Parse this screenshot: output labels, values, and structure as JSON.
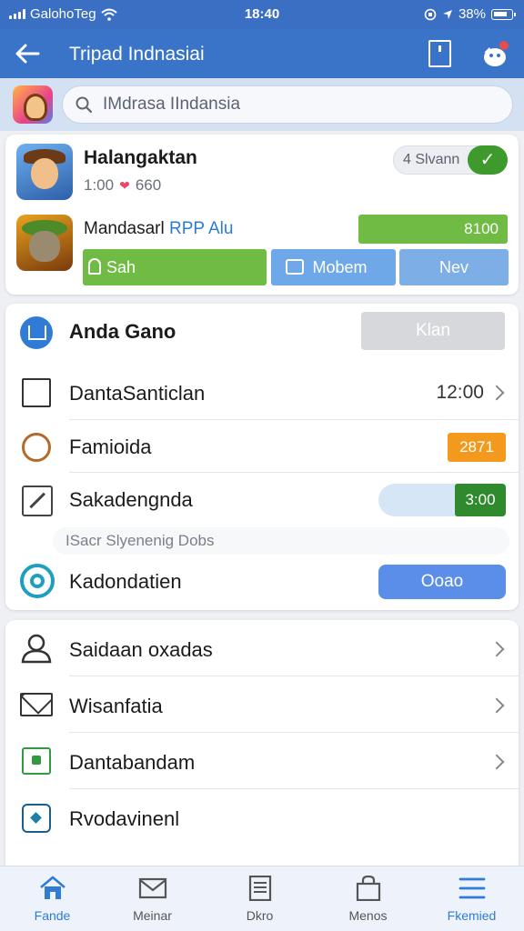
{
  "status": {
    "carrier": "GalohoTeg",
    "time": "18:40",
    "battery": "38%"
  },
  "appbar": {
    "title": "Tripad Indnasiai",
    "back_icon": "arrow-left-icon",
    "bookmark_icon": "bookmark-icon",
    "mascot_icon": "mascot-notification-icon"
  },
  "search": {
    "placeholder": "IMdrasa IIndansia"
  },
  "games": [
    {
      "name": "Halangaktan",
      "count": "1:00",
      "likes": "660",
      "toggle_label": "4 Slvann",
      "toggle_on": true
    },
    {
      "name_prefix": "Mandasarl",
      "name_highlight": "RPP Alu",
      "price": "8100",
      "buttons": [
        "Sah",
        "Mobem",
        "Nev"
      ]
    }
  ],
  "panel": {
    "header": {
      "title": "Anda Gano",
      "button": "Klan"
    },
    "rows": [
      {
        "label": "DantaSanticlan",
        "value": "12:00"
      },
      {
        "label": "Famioida",
        "badge": "2871"
      },
      {
        "label": "Sakadengnda",
        "value": "3:00"
      },
      {
        "hint": "ISacr Slyenenig Dobs"
      },
      {
        "label": "Kadondatien",
        "button": "Ooao"
      }
    ]
  },
  "menu": [
    {
      "label": "Saidaan oxadas",
      "icon": "user-icon"
    },
    {
      "label": "Wisanfatia",
      "icon": "mail-icon"
    },
    {
      "label": "Dantabandam",
      "icon": "folder-icon"
    },
    {
      "label": "Rvodavinenl",
      "icon": "diamond-icon"
    }
  ],
  "tabs": [
    {
      "label": "Fande",
      "icon": "home-icon",
      "active": true
    },
    {
      "label": "Meinar",
      "icon": "mail-icon",
      "active": false
    },
    {
      "label": "Dkro",
      "icon": "document-icon",
      "active": false
    },
    {
      "label": "Menos",
      "icon": "shopping-bag-icon",
      "active": false
    },
    {
      "label": "Fkemied",
      "icon": "menu-icon",
      "active": true
    }
  ],
  "colors": {
    "primary": "#3a74c9",
    "green": "#6fbb44",
    "dark_green": "#2f8a2e",
    "orange": "#f39a1e",
    "blue_button": "#5b8ee8"
  }
}
